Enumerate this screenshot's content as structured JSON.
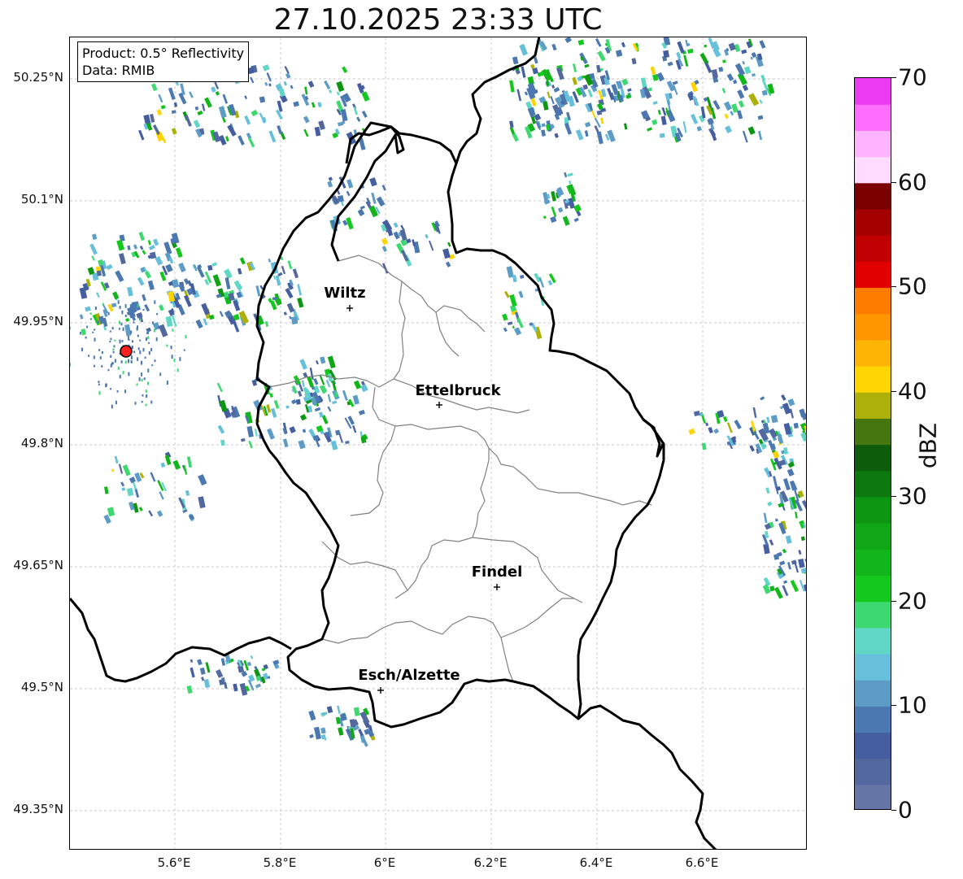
{
  "title": "27.10.2025 23:33 UTC",
  "info": {
    "product": "Product: 0.5° Reflectivity",
    "data": "Data: RMIB"
  },
  "axes": {
    "lat_ticks": [
      "50.25°N",
      "50.1°N",
      "49.95°N",
      "49.8°N",
      "49.65°N",
      "49.5°N",
      "49.35°N"
    ],
    "lon_ticks": [
      "5.6°E",
      "5.8°E",
      "6°E",
      "6.2°E",
      "6.4°E",
      "6.6°E"
    ]
  },
  "cities": [
    {
      "name": "Wiltz"
    },
    {
      "name": "Ettelbruck"
    },
    {
      "name": "Findel"
    },
    {
      "name": "Esch/Alzette"
    }
  ],
  "colorbar": {
    "label": "dBZ",
    "ticks": [
      "0",
      "10",
      "20",
      "30",
      "40",
      "50",
      "60",
      "70"
    ],
    "colors": [
      "#6475a6",
      "#5468a0",
      "#445ea0",
      "#4b78b0",
      "#5c9cc6",
      "#66c0dc",
      "#5fd6c6",
      "#3ed870",
      "#14c81e",
      "#12b61a",
      "#10a616",
      "#0d9612",
      "#0c780e",
      "#0c5c0c",
      "#467610",
      "#aeb00a",
      "#fed500",
      "#feb405",
      "#fe9600",
      "#fe7c00",
      "#e00000",
      "#c00000",
      "#a40000",
      "#7a0000",
      "#ffdcff",
      "#ffb4ff",
      "#ff6eff",
      "#ec3af0"
    ]
  },
  "colors": {
    "border_national": "#000000",
    "border_cantonal": "#808080",
    "radar_site": "#ff2020"
  }
}
